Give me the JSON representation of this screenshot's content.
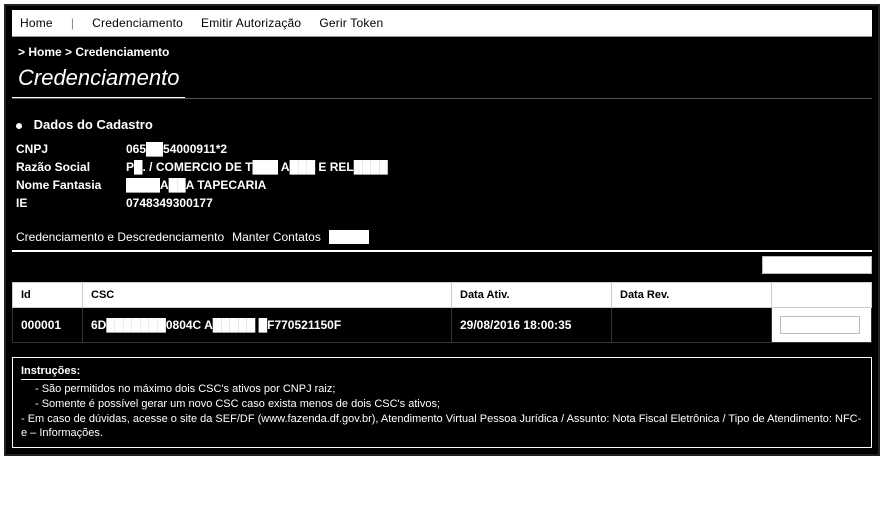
{
  "nav": {
    "items": [
      "Home",
      "|",
      "Credenciamento",
      "Emitir Autorização",
      "Gerir Token"
    ]
  },
  "breadcrumb": "> Home > Credenciamento",
  "page_title": "Credenciamento",
  "section_title": "Dados do Cadastro",
  "cad": {
    "cnpj_label": "CNPJ",
    "cnpj_value": "065██54000911*2",
    "razao_label": "Razão Social",
    "razao_value": "P█. / COMERCIO DE T███ A███ E REL████",
    "fantasia_label": "Nome Fantasia",
    "fantasia_value": "████A██A TAPECARIA",
    "ie_label": "IE",
    "ie_value": "0748349300177"
  },
  "tabs": {
    "t1": "Credenciamento e Descredenciamento",
    "t2": "Manter Contatos",
    "t3": ""
  },
  "toolbar": {
    "novo": ""
  },
  "table": {
    "h1": "Id",
    "h2": "CSC",
    "h3": "Data Ativ.",
    "h4": "Data Rev.",
    "h5": "",
    "r1c1": "000001",
    "r1c2": "6D███████0804C A█████ █F770521150F",
    "r1c3": "29/08/2016 18:00:35",
    "r1c4": "",
    "r1c5": ""
  },
  "footer_link": "",
  "instr": {
    "head": "Instruções:",
    "l1": "- São permitidos no máximo dois CSC's ativos por CNPJ raiz;",
    "l2": "- Somente é possível gerar um novo CSC caso exista menos de dois CSC's ativos;",
    "l3": "- Em caso de dúvidas, acesse o site da SEF/DF (www.fazenda.df.gov.br), Atendimento Virtual Pessoa Jurídica / Assunto: Nota Fiscal Eletrônica / Tipo de Atendimento: NFC-e – Informações."
  }
}
